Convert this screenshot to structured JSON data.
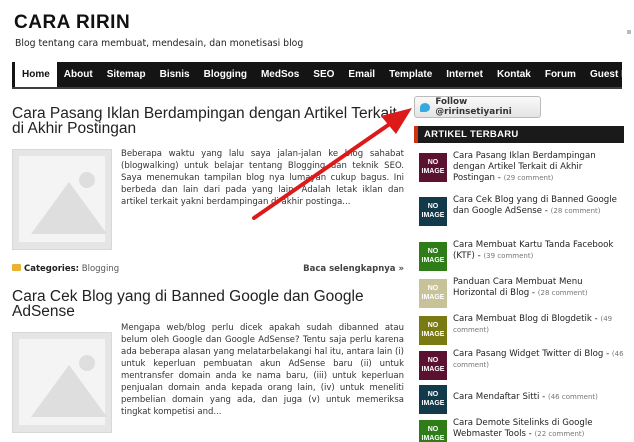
{
  "site": {
    "title": "CARA RIRIN",
    "description": "Blog tentang cara membuat, mendesain, dan monetisasi blog"
  },
  "nav": {
    "items": [
      {
        "label": "Home"
      },
      {
        "label": "About"
      },
      {
        "label": "Sitemap"
      },
      {
        "label": "Bisnis"
      },
      {
        "label": "Blogging"
      },
      {
        "label": "MedSos"
      },
      {
        "label": "SEO"
      },
      {
        "label": "Email"
      },
      {
        "label": "Template"
      },
      {
        "label": "Internet"
      },
      {
        "label": "Kontak"
      },
      {
        "label": "Forum"
      },
      {
        "label": "Guest Book"
      }
    ]
  },
  "posts": [
    {
      "title": "Cara Pasang Iklan Berdampingan dengan Artikel Terkait di Akhir Postingan",
      "excerpt": "Beberapa waktu yang lalu saya jalan-jalan ke blog sahabat (blogwalking) untuk belajar tentang Blogging dan teknik SEO. Saya menemukan tampilan blog nya lumayan cukup bagus. Ini berbeda dan lain dari pada yang lain. Adalah letak iklan dan artikel terkait yakni berdampingan di akhir postinga...",
      "category_label": "Categories:",
      "category": "Blogging",
      "read_more": "Baca selengkapnya »"
    },
    {
      "title": "Cara Cek Blog yang di Banned Google dan Google AdSense",
      "excerpt": "Mengapa web/blog perlu dicek apakah sudah dibanned atau belum oleh Google dan Google AdSense? Tentu saja perlu karena ada beberapa alasan yang melatarbelakangi hal itu, antara lain (i) untuk keperluan pembuatan akun AdSense baru (ii) untuk mentransfer domain anda ke nama baru, (iii) untuk keperluan penjualan domain anda kepada orang lain, (iv) untuk meneliti pembelian domain yang ada, dan juga (v) untuk memeriksa tingkat kompetisi and..."
    }
  ],
  "sidebar": {
    "follow_label": "Follow @ririnsetiyarini",
    "widget_title": "ARTIKEL TERBARU",
    "noimage_line1": "NO",
    "noimage_line2": "IMAGE",
    "items": [
      {
        "title": "Cara Pasang Iklan Berdampingan dengan Artikel Terkait di Akhir Postingan",
        "count": "(29 comment)",
        "color": "#5a1230"
      },
      {
        "title": "Cara Cek Blog yang di Banned Google dan Google AdSense",
        "count": "(28 comment)",
        "color": "#123a4a"
      },
      {
        "title": "Cara Membuat Kartu Tanda Facebook (KTF)",
        "count": "(39 comment)",
        "color": "#2e7d18"
      },
      {
        "title": "Panduan Cara Membuat Menu Horizontal di Blog",
        "count": "(28 comment)",
        "color": "#c7c29a"
      },
      {
        "title": "Cara Membuat Blog di Blogdetik",
        "count": "(49 comment)",
        "color": "#7a7a12"
      },
      {
        "title": "Cara Pasang Widget Twitter di Blog",
        "count": "(46 comment)",
        "color": "#5a1230"
      },
      {
        "title": "Cara Mendaftar Sitti",
        "count": "(46 comment)",
        "color": "#123a4a"
      },
      {
        "title": "Cara Demote Sitelinks di Google Webmaster Tools",
        "count": "(22 comment)",
        "color": "#2e7d18"
      }
    ]
  },
  "colors": {
    "nav_bg": "#141414",
    "widget_accent": "#cc3311",
    "arrow": "#dd1a1a",
    "twitter": "#36a9e1"
  }
}
